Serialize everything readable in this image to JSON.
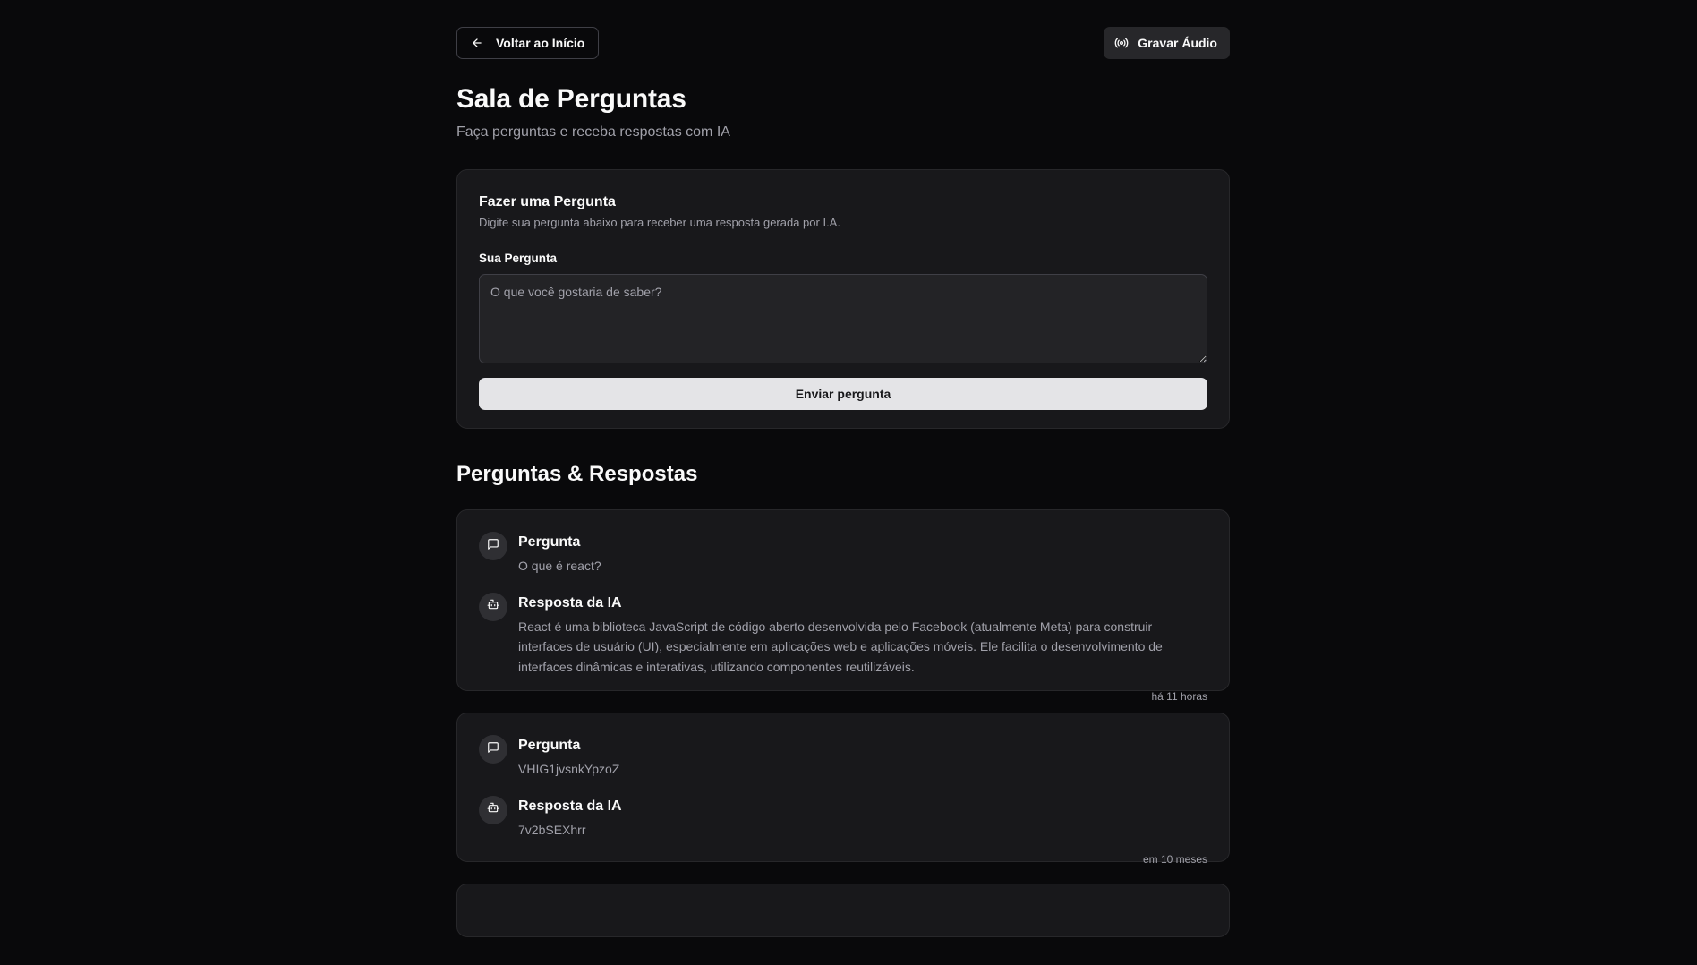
{
  "header": {
    "back_label": "Voltar ao Início",
    "record_label": "Gravar Áudio"
  },
  "page": {
    "title": "Sala de Perguntas",
    "subtitle": "Faça perguntas e receba respostas com IA"
  },
  "ask_form": {
    "title": "Fazer uma Pergunta",
    "description": "Digite sua pergunta abaixo para receber uma resposta gerada por I.A.",
    "field_label": "Sua Pergunta",
    "placeholder": "O que você gostaria de saber?",
    "value": "",
    "submit_label": "Enviar pergunta"
  },
  "qa_section": {
    "title": "Perguntas & Respostas",
    "items": [
      {
        "question_label": "Pergunta",
        "question": "O que é react?",
        "answer_label": "Resposta da IA",
        "answer": "React é uma biblioteca JavaScript de código aberto desenvolvida pelo Facebook (atualmente Meta) para construir interfaces de usuário (UI), especialmente em aplicações web e aplicações móveis. Ele facilita o desenvolvimento de interfaces dinâmicas e interativas, utilizando componentes reutilizáveis.",
        "time": "há 11 horas"
      },
      {
        "question_label": "Pergunta",
        "question": "VHIG1jvsnkYpzoZ",
        "answer_label": "Resposta da IA",
        "answer": "7v2bSEXhrr",
        "time": "em 10 meses"
      }
    ]
  },
  "icons": {
    "back": "arrow-left-icon",
    "record": "radio-waves-icon",
    "question": "message-square-icon",
    "answer": "bot-icon"
  },
  "colors": {
    "background": "#09090b",
    "card": "#18181b",
    "border": "#27272a",
    "muted_text": "#a1a1aa",
    "primary_button": "#e4e4e7"
  }
}
